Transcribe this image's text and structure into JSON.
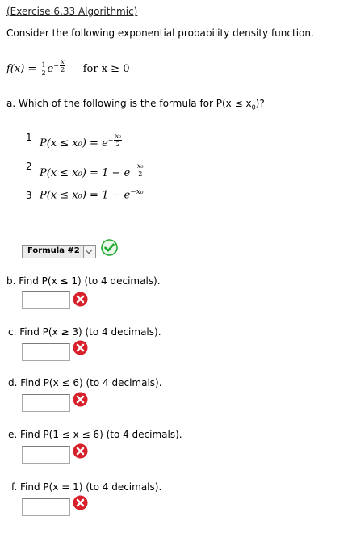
{
  "header": {
    "link_text": "(Exercise 6.33 Algorithmic)"
  },
  "intro": "Consider the following exponential probability density function.",
  "pdf": {
    "lhs": "f(x) = ",
    "coef_num": "1",
    "coef_den": "2",
    "base": "e",
    "exp_sign": "−",
    "exp_num": "x",
    "exp_den": "2",
    "condition": "for  x ≥ 0"
  },
  "part_a": {
    "question": "a. Which of the following is the formula for P(x ≤ x",
    "question_sub": "0",
    "question_end": ")?",
    "options": [
      {
        "num": "1",
        "formula": "P(x ≤ x₀) = e",
        "exp": "−",
        "exp_num": "x₀",
        "exp_den": "2"
      },
      {
        "num": "2",
        "formula": "P(x ≤ x₀) = 1 − e",
        "exp": "−",
        "exp_num": "x₀",
        "exp_den": "2"
      },
      {
        "num": "3",
        "formula": "P(x ≤ x₀) = 1 − e",
        "exp_text": "−x₀"
      }
    ],
    "selected": "Formula #2",
    "status": "correct"
  },
  "parts": [
    {
      "question": "b. Find P(x ≤ 1) (to 4 decimals).",
      "value": "",
      "status": "incorrect"
    },
    {
      "question": "c. Find P(x ≥ 3) (to 4 decimals).",
      "value": "",
      "status": "incorrect"
    },
    {
      "question": "d. Find P(x ≤ 6) (to 4 decimals).",
      "value": "",
      "status": "incorrect"
    },
    {
      "question": "e. Find P(1 ≤ x ≤ 6) (to 4 decimals).",
      "value": "",
      "status": "incorrect"
    },
    {
      "question": "f. Find P(x = 1) (to 4 decimals).",
      "value": "",
      "status": "incorrect"
    }
  ],
  "colors": {
    "correct_green": "#1fa82e",
    "incorrect_red": "#d8202a"
  }
}
